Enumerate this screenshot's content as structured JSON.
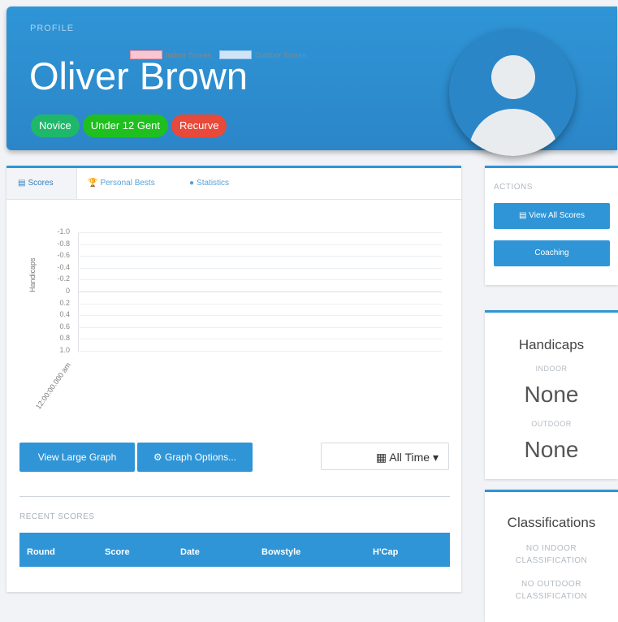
{
  "header": {
    "profile_label": "PROFILE",
    "name": "Oliver Brown",
    "badges": [
      {
        "label": "Novice",
        "color": "#1fb86b"
      },
      {
        "label": "Under 12 Gent",
        "color": "#1fbf1f"
      },
      {
        "label": "Recurve",
        "color": "#e7493a"
      }
    ]
  },
  "tabs": [
    {
      "label": "Scores",
      "icon": "chart-icon",
      "active": true
    },
    {
      "label": "Personal Bests",
      "icon": "trophy-icon",
      "active": false
    },
    {
      "label": "Statistics",
      "icon": "pin-icon",
      "active": false
    }
  ],
  "chart_data": {
    "type": "line",
    "series": [
      {
        "name": "Indoor Scores",
        "values": []
      },
      {
        "name": "Outdoor Scores",
        "values": []
      }
    ],
    "ylabel": "Handicaps",
    "xlabel": "",
    "ylim": [
      -1.0,
      1.0
    ],
    "y_reversed": true,
    "y_ticks": [
      "-1.0",
      "-0.8",
      "-0.6",
      "-0.4",
      "-0.2",
      "0",
      "0.2",
      "0.4",
      "0.6",
      "0.8",
      "1.0"
    ],
    "x_ticks": [
      "12:00:00.000 am"
    ],
    "legend_position": "top"
  },
  "buttons": {
    "view_large_graph": "View Large Graph",
    "graph_options": "Graph Options...",
    "time_range": "All Time"
  },
  "recent_scores": {
    "label": "RECENT SCORES",
    "columns": [
      "Round",
      "Score",
      "Date",
      "Bowstyle",
      "H'Cap"
    ]
  },
  "actions": {
    "label": "ACTIONS",
    "view_all_scores": "View All Scores",
    "coaching": "Coaching"
  },
  "handicaps": {
    "title": "Handicaps",
    "indoor_label": "INDOOR",
    "indoor_value": "None",
    "outdoor_label": "OUTDOOR",
    "outdoor_value": "None"
  },
  "classifications": {
    "title": "Classifications",
    "indoor_text": "NO INDOOR CLASSIFICATION",
    "outdoor_text": "NO OUTDOOR CLASSIFICATION"
  }
}
